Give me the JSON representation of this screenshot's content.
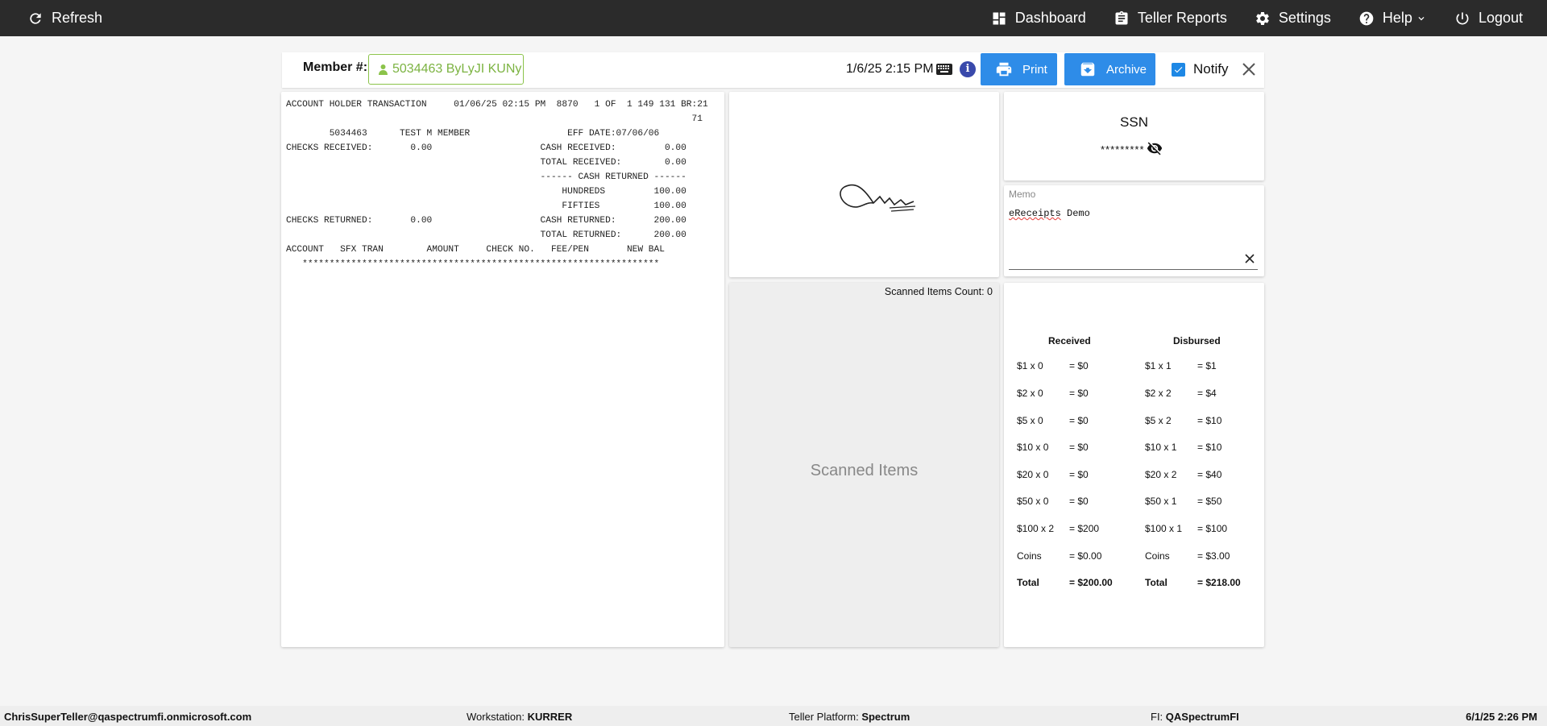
{
  "topbar": {
    "refresh": "Refresh",
    "nav": [
      {
        "label": "Dashboard",
        "icon": "dashboard-icon"
      },
      {
        "label": "Teller Reports",
        "icon": "clipboard-icon"
      },
      {
        "label": "Settings",
        "icon": "gear-icon"
      },
      {
        "label": "Help",
        "icon": "help-icon"
      },
      {
        "label": "Logout",
        "icon": "power-icon"
      }
    ]
  },
  "member": {
    "label": "Member #:",
    "value": "5034463 ByLyJI KUNy",
    "datetime": "1/6/25 2:15 PM",
    "print": "Print",
    "archive": "Archive",
    "notify": "Notify"
  },
  "receipt": {
    "lines": [
      "ACCOUNT HOLDER TRANSACTION     01/06/25 02:15 PM  8870   1 OF  1 149 131 BR:21",
      "                                                                           71",
      "        5034463      TEST M MEMBER                  EFF DATE:07/06/06",
      "CHECKS RECEIVED:       0.00                    CASH RECEIVED:         0.00",
      "                                               TOTAL RECEIVED:        0.00",
      "                                               ------ CASH RETURNED ------",
      "                                                   HUNDREDS         100.00",
      "                                                   FIFTIES          100.00",
      "CHECKS RETURNED:       0.00                    CASH RETURNED:       200.00",
      "                                               TOTAL RETURNED:      200.00",
      "ACCOUNT   SFX TRAN        AMOUNT     CHECK NO.   FEE/PEN       NEW BAL",
      "   ******************************************************************"
    ]
  },
  "scanned": {
    "count_label": "Scanned Items Count: 0",
    "placeholder": "Scanned Items"
  },
  "ssn": {
    "title": "SSN",
    "masked": "*********"
  },
  "memo": {
    "label": "Memo",
    "word1": "eReceipts",
    "word2": " Demo"
  },
  "cash": {
    "received_title": "Received",
    "disbursed_title": "Disbursed",
    "received": [
      {
        "d": "$1 x 0",
        "v": "= $0"
      },
      {
        "d": "$2 x 0",
        "v": "= $0"
      },
      {
        "d": "$5 x 0",
        "v": "= $0"
      },
      {
        "d": "$10 x 0",
        "v": "= $0"
      },
      {
        "d": "$20 x 0",
        "v": "= $0"
      },
      {
        "d": "$50 x 0",
        "v": "= $0"
      },
      {
        "d": "$100 x 2",
        "v": "= $200"
      },
      {
        "d": "Coins",
        "v": "= $0.00"
      },
      {
        "d": "Total",
        "v": "= $200.00"
      }
    ],
    "disbursed": [
      {
        "d": "$1 x 1",
        "v": "= $1"
      },
      {
        "d": "$2 x 2",
        "v": "= $4"
      },
      {
        "d": "$5 x 2",
        "v": "= $10"
      },
      {
        "d": "$10 x 1",
        "v": "= $10"
      },
      {
        "d": "$20 x 2",
        "v": "= $40"
      },
      {
        "d": "$50 x 1",
        "v": "= $50"
      },
      {
        "d": "$100 x 1",
        "v": "= $100"
      },
      {
        "d": "Coins",
        "v": "= $3.00"
      },
      {
        "d": "Total",
        "v": "= $218.00"
      }
    ]
  },
  "status": {
    "user": "ChrisSuperTeller@qaspectrumfi.onmicrosoft.com",
    "workstation_label": "Workstation: ",
    "workstation": "KURRER",
    "platform_label": "Teller Platform: ",
    "platform": "Spectrum",
    "fi_label": "FI: ",
    "fi": "QASpectrumFI",
    "datetime": "6/1/25 2:26 PM"
  },
  "colors": {
    "topbar": "#2b2b2b",
    "button_blue": "#2e8ce8",
    "member_green": "#7cb342"
  }
}
